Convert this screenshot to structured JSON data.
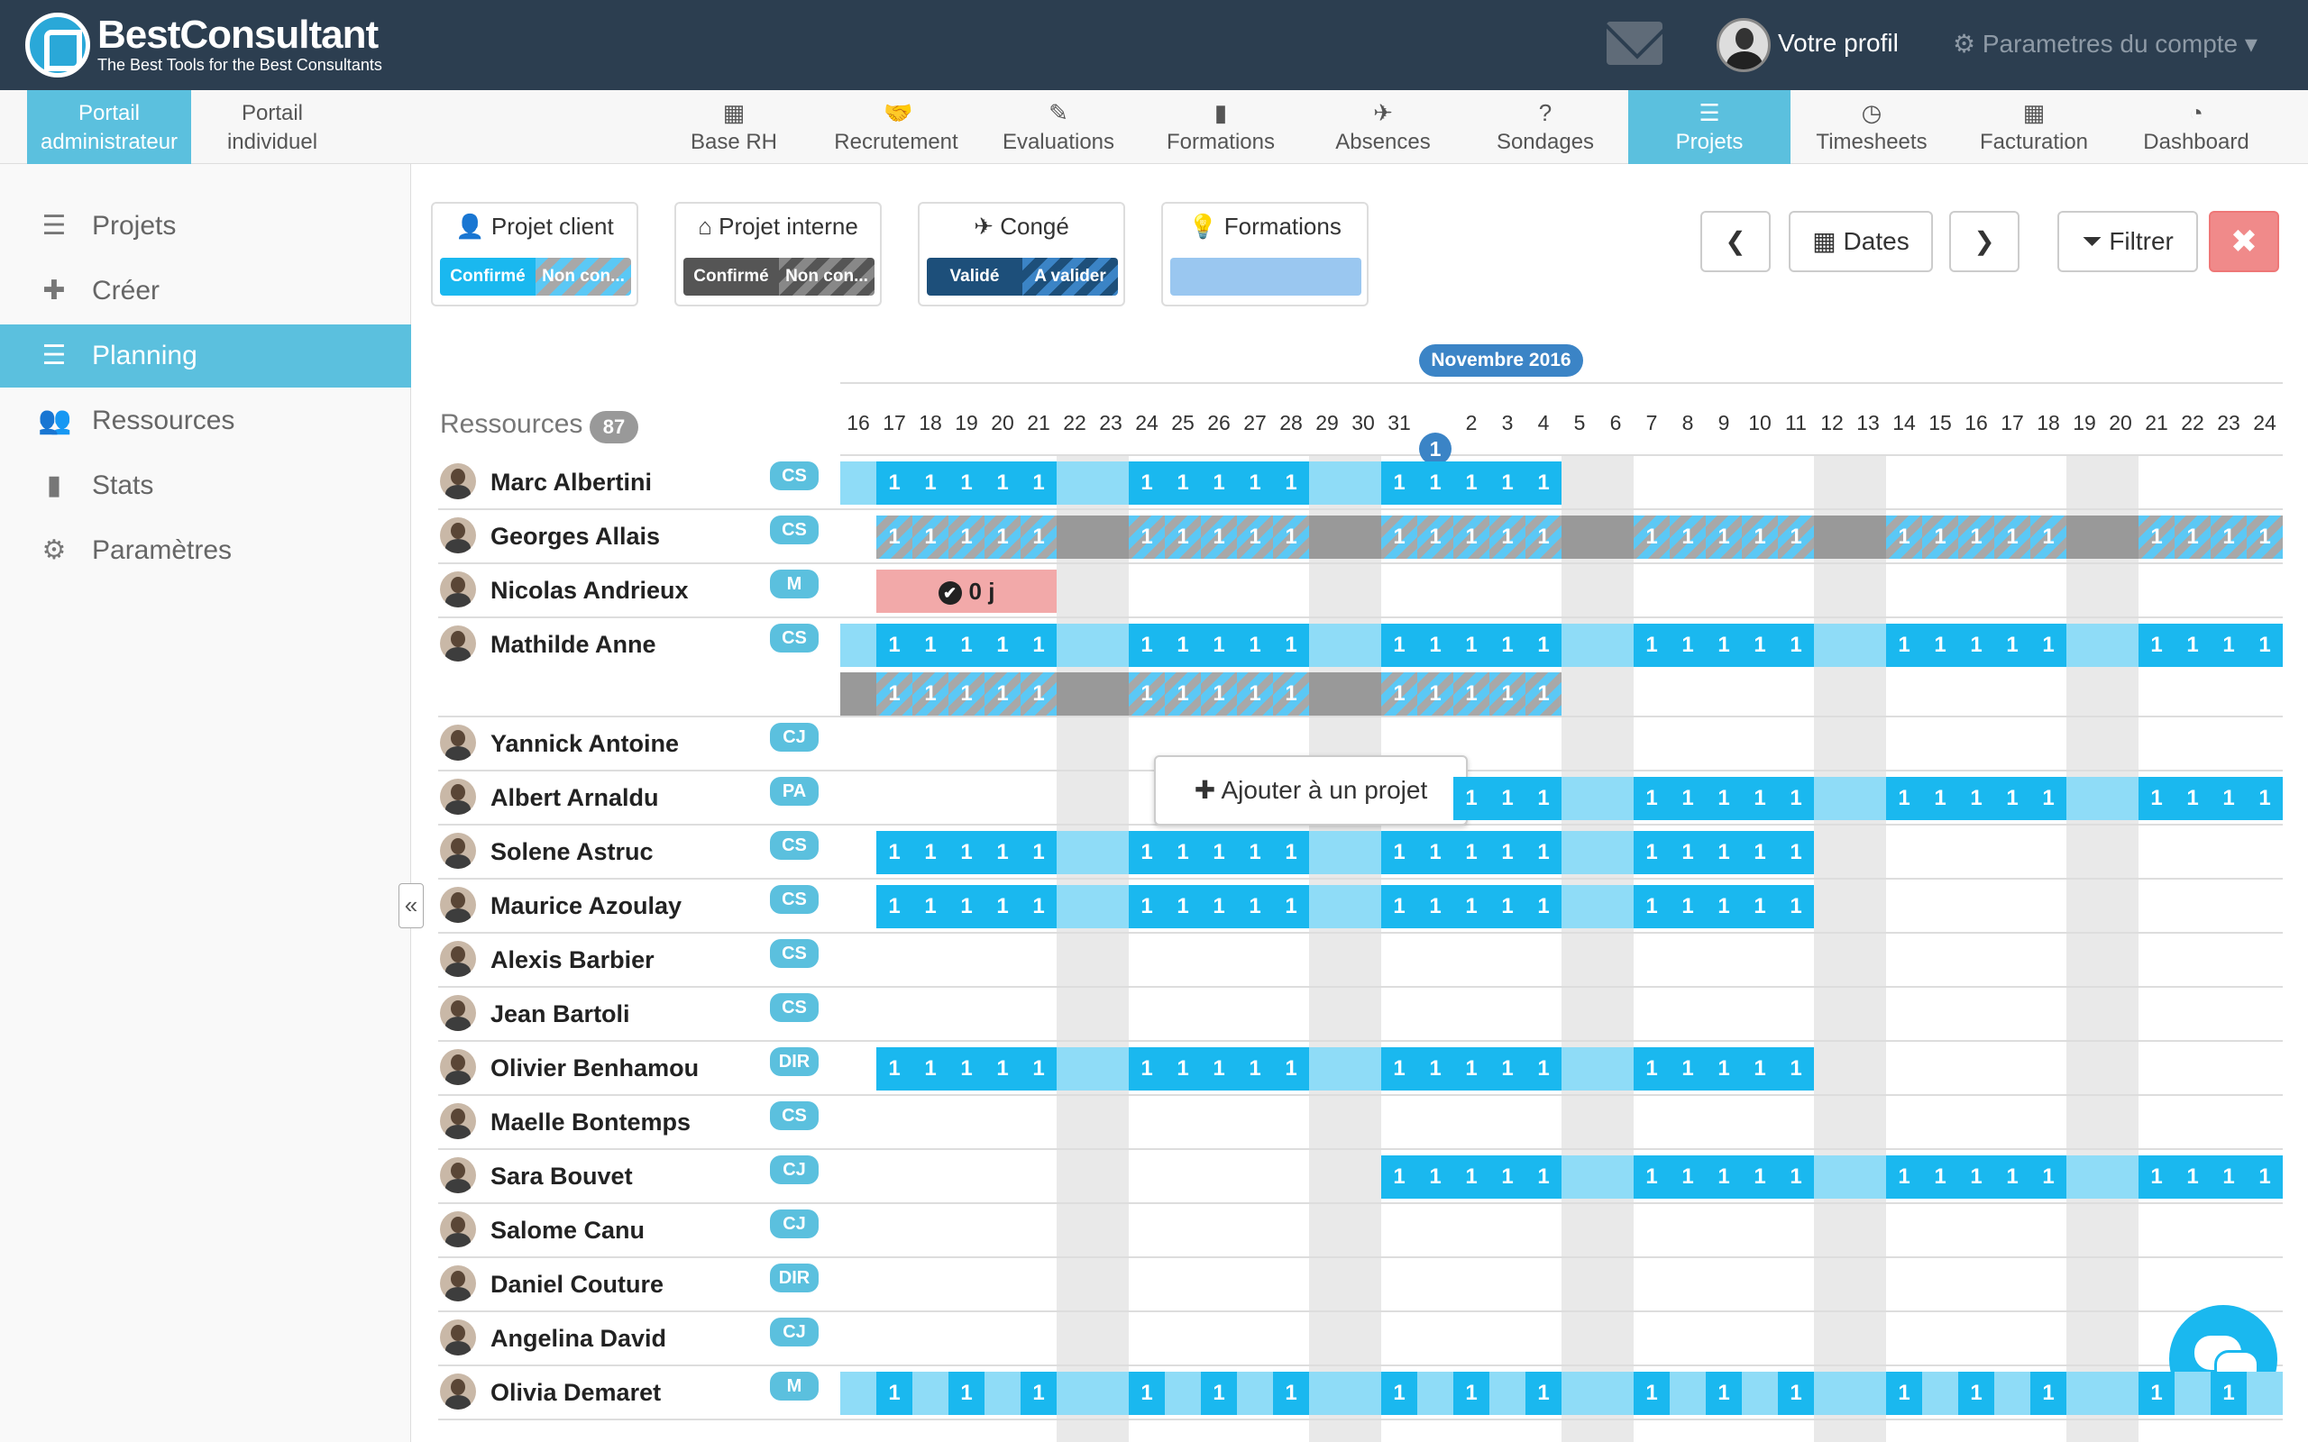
{
  "header": {
    "brand": "BestConsultant",
    "tagline": "The Best Tools for the Best Consultants",
    "profile": "Votre profil",
    "account": "⚙ Parametres du compte ▾"
  },
  "portals": [
    {
      "line1": "Portail",
      "line2": "administrateur"
    },
    {
      "line1": "Portail",
      "line2": "individuel"
    }
  ],
  "nav": [
    {
      "label": "Base RH",
      "icon": "grid-icon"
    },
    {
      "label": "Recrutement",
      "icon": "handshake-icon"
    },
    {
      "label": "Evaluations",
      "icon": "pencil-icon"
    },
    {
      "label": "Formations",
      "icon": "book-icon"
    },
    {
      "label": "Absences",
      "icon": "plane-icon"
    },
    {
      "label": "Sondages",
      "icon": "question-icon"
    },
    {
      "label": "Projets",
      "icon": "stack-icon"
    },
    {
      "label": "Timesheets",
      "icon": "clock-icon"
    },
    {
      "label": "Facturation",
      "icon": "calculator-icon"
    },
    {
      "label": "Dashboard",
      "icon": "pie-icon"
    }
  ],
  "sidebar": [
    {
      "label": "Projets",
      "icon": "list-icon"
    },
    {
      "label": "Créer",
      "icon": "plus-icon"
    },
    {
      "label": "Planning",
      "icon": "stack-icon"
    },
    {
      "label": "Ressources",
      "icon": "users-icon"
    },
    {
      "label": "Stats",
      "icon": "bars-icon"
    },
    {
      "label": "Paramètres",
      "icon": "gear-icon"
    }
  ],
  "legend": {
    "client": {
      "title": "Projet client",
      "a": "Confirmé",
      "b": "Non con..."
    },
    "interne": {
      "title": "Projet interne",
      "a": "Confirmé",
      "b": "Non con..."
    },
    "conge": {
      "title": "Congé",
      "a": "Validé",
      "b": "A valider"
    },
    "formations": {
      "title": "Formations"
    }
  },
  "toolbar": {
    "dates": "Dates",
    "filter": "Filtrer"
  },
  "month": "Novembre 2016",
  "resources_label": "Ressources",
  "resources_count": "87",
  "days": [
    "16",
    "17",
    "18",
    "19",
    "20",
    "21",
    "22",
    "23",
    "24",
    "25",
    "26",
    "27",
    "28",
    "29",
    "30",
    "31",
    "1",
    "2",
    "3",
    "4",
    "5",
    "6",
    "7",
    "8",
    "9",
    "10",
    "11",
    "12",
    "13",
    "14",
    "15",
    "16",
    "17",
    "18",
    "19",
    "20",
    "21",
    "22",
    "23",
    "24"
  ],
  "today_label": "1",
  "cell_value": "1",
  "conge_value": "0 j",
  "conge_check": "✔",
  "tooltip": "Ajouter à un projet",
  "rows": [
    {
      "name": "Marc Albertini",
      "role": "CS"
    },
    {
      "name": "Georges Allais",
      "role": "CS"
    },
    {
      "name": "Nicolas Andrieux",
      "role": "M"
    },
    {
      "name": "Mathilde Anne",
      "role": "CS"
    },
    {
      "name": "Yannick Antoine",
      "role": "CJ"
    },
    {
      "name": "Albert Arnaldu",
      "role": "PA"
    },
    {
      "name": "Solene Astruc",
      "role": "CS"
    },
    {
      "name": "Maurice Azoulay",
      "role": "CS"
    },
    {
      "name": "Alexis Barbier",
      "role": "CS"
    },
    {
      "name": "Jean Bartoli",
      "role": "CS"
    },
    {
      "name": "Olivier Benhamou",
      "role": "DIR"
    },
    {
      "name": "Maelle Bontemps",
      "role": "CS"
    },
    {
      "name": "Sara Bouvet",
      "role": "CJ"
    },
    {
      "name": "Salome Canu",
      "role": "CJ"
    },
    {
      "name": "Daniel Couture",
      "role": "DIR"
    },
    {
      "name": "Angelina David",
      "role": "CJ"
    },
    {
      "name": "Olivia Demaret",
      "role": "M"
    }
  ]
}
